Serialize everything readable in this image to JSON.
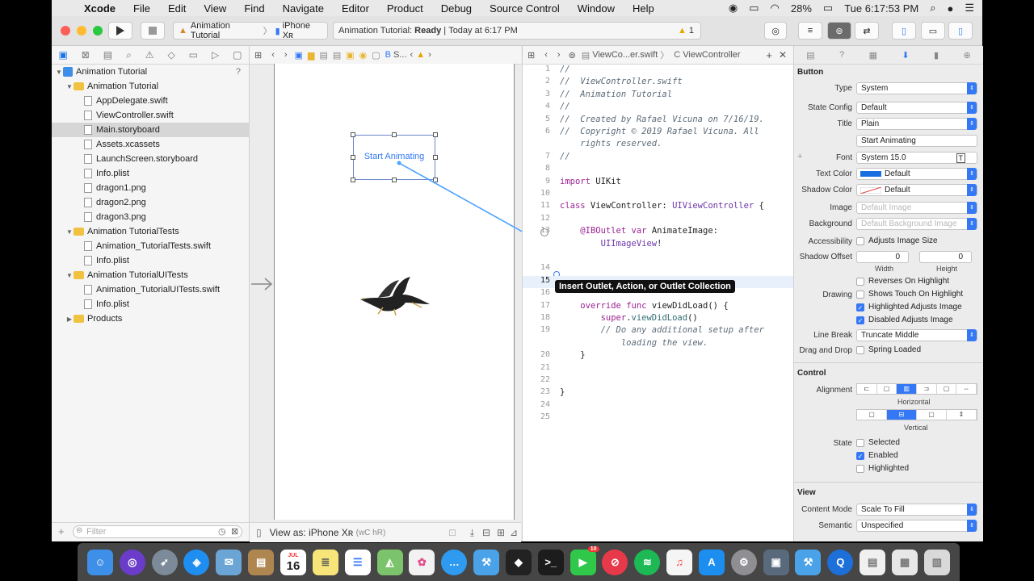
{
  "menubar": {
    "apple": "",
    "app_name": "Xcode",
    "items": [
      "File",
      "Edit",
      "View",
      "Find",
      "Navigate",
      "Editor",
      "Product",
      "Debug",
      "Source Control",
      "Window",
      "Help"
    ],
    "battery": "28%",
    "clock": "Tue 6:17:53 PM"
  },
  "toolbar": {
    "scheme": "Animation Tutorial",
    "device": "iPhone Xʀ",
    "status_app": "Animation Tutorial:",
    "status_state": "Ready",
    "status_time": "Today at 6:17 PM",
    "warning_count": "1"
  },
  "navigator": {
    "rows": [
      {
        "label": "Animation Tutorial",
        "kind": "project",
        "indent": 0,
        "tri": "▼",
        "extra": "?"
      },
      {
        "label": "Animation Tutorial",
        "kind": "folder",
        "indent": 1,
        "tri": "▼"
      },
      {
        "label": "AppDelegate.swift",
        "kind": "file",
        "indent": 2,
        "tri": ""
      },
      {
        "label": "ViewController.swift",
        "kind": "file",
        "indent": 2,
        "tri": ""
      },
      {
        "label": "Main.storyboard",
        "kind": "file",
        "indent": 2,
        "tri": "",
        "selected": true
      },
      {
        "label": "Assets.xcassets",
        "kind": "file",
        "indent": 2,
        "tri": ""
      },
      {
        "label": "LaunchScreen.storyboard",
        "kind": "file",
        "indent": 2,
        "tri": ""
      },
      {
        "label": "Info.plist",
        "kind": "file",
        "indent": 2,
        "tri": ""
      },
      {
        "label": "dragon1.png",
        "kind": "file",
        "indent": 2,
        "tri": ""
      },
      {
        "label": "dragon2.png",
        "kind": "file",
        "indent": 2,
        "tri": ""
      },
      {
        "label": "dragon3.png",
        "kind": "file",
        "indent": 2,
        "tri": ""
      },
      {
        "label": "Animation TutorialTests",
        "kind": "folder",
        "indent": 1,
        "tri": "▼"
      },
      {
        "label": "Animation_TutorialTests.swift",
        "kind": "file",
        "indent": 2,
        "tri": ""
      },
      {
        "label": "Info.plist",
        "kind": "file",
        "indent": 2,
        "tri": ""
      },
      {
        "label": "Animation TutorialUITests",
        "kind": "folder",
        "indent": 1,
        "tri": "▼"
      },
      {
        "label": "Animation_TutorialUITests.swift",
        "kind": "file",
        "indent": 2,
        "tri": ""
      },
      {
        "label": "Info.plist",
        "kind": "file",
        "indent": 2,
        "tri": ""
      },
      {
        "label": "Products",
        "kind": "folder",
        "indent": 1,
        "tri": "▶"
      }
    ],
    "filter_placeholder": "Filter"
  },
  "canvas": {
    "jump_tail": "S...",
    "button_title": "Start Animating",
    "view_as": "View as: iPhone Xʀ",
    "size_class": "(wC hR)"
  },
  "editor": {
    "jump_file": "ViewCo...er.swift",
    "jump_symbol": "ViewController",
    "tooltip": "Insert Outlet, Action, or Outlet Collection",
    "lines": [
      {
        "n": "1",
        "html": "<span class='cm'>//</span>"
      },
      {
        "n": "2",
        "html": "<span class='cm'>//  ViewController.swift</span>"
      },
      {
        "n": "3",
        "html": "<span class='cm'>//  Animation Tutorial</span>"
      },
      {
        "n": "4",
        "html": "<span class='cm'>//</span>"
      },
      {
        "n": "5",
        "html": "<span class='cm'>//  Created by Rafael Vicuna on 7/16/19.</span>"
      },
      {
        "n": "6",
        "html": "<span class='cm'>//  Copyright © 2019 Rafael Vicuna. All</span>"
      },
      {
        "n": "",
        "html": "<span class='cm'>    rights reserved.</span>"
      },
      {
        "n": "7",
        "html": "<span class='cm'>//</span>"
      },
      {
        "n": "8",
        "html": ""
      },
      {
        "n": "9",
        "html": "<span class='kw'>import</span> UIKit"
      },
      {
        "n": "10",
        "html": ""
      },
      {
        "n": "11",
        "html": "<span class='kw'>class</span> ViewController: <span class='ty'>UIViewController</span> {"
      },
      {
        "n": "12",
        "html": ""
      },
      {
        "n": "13",
        "html": "    <span class='kw'>@IBOutlet</span> <span class='kw'>var</span> AnimateImage:"
      },
      {
        "n": "",
        "html": "        <span class='ty'>UIImageView</span>!"
      },
      {
        "n": "",
        "html": ""
      },
      {
        "n": "14",
        "html": ""
      },
      {
        "n": "15",
        "html": ""
      },
      {
        "n": "16",
        "html": ""
      },
      {
        "n": "17",
        "html": "    <span class='kw'>override</span> <span class='kw'>func</span> viewDidLoad() {"
      },
      {
        "n": "18",
        "html": "        <span class='kw'>super</span>.<span class='fn'>viewDidLoad</span>()"
      },
      {
        "n": "19",
        "html": "        <span class='cm'>// Do any additional setup after</span>"
      },
      {
        "n": "",
        "html": "<span class='cm'>            loading the view.</span>"
      },
      {
        "n": "20",
        "html": "    }"
      },
      {
        "n": "21",
        "html": ""
      },
      {
        "n": "22",
        "html": ""
      },
      {
        "n": "23",
        "html": "}"
      },
      {
        "n": "24",
        "html": ""
      },
      {
        "n": "25",
        "html": ""
      }
    ]
  },
  "inspector": {
    "section_button": "Button",
    "type_label": "Type",
    "type_value": "System",
    "state_config_label": "State Config",
    "state_config_value": "Default",
    "title_label": "Title",
    "title_value": "Plain",
    "title_text": "Start Animating",
    "font_label": "Font",
    "font_value": "System 15.0",
    "text_color_label": "Text Color",
    "text_color_value": "Default",
    "shadow_color_label": "Shadow Color",
    "shadow_color_value": "Default",
    "image_label": "Image",
    "image_placeholder": "Default Image",
    "background_label": "Background",
    "background_placeholder": "Default Background Image",
    "accessibility_label": "Accessibility",
    "adjusts_image_size": "Adjusts Image Size",
    "shadow_offset_label": "Shadow Offset",
    "shadow_w": "0",
    "shadow_h": "0",
    "width_label": "Width",
    "height_label": "Height",
    "reverses": "Reverses On Highlight",
    "drawing_label": "Drawing",
    "shows_touch": "Shows Touch On Highlight",
    "highlighted_adjusts": "Highlighted Adjusts Image",
    "disabled_adjusts": "Disabled Adjusts Image",
    "line_break_label": "Line Break",
    "line_break_value": "Truncate Middle",
    "drag_drop_label": "Drag and Drop",
    "spring_loaded": "Spring Loaded",
    "section_control": "Control",
    "alignment_label": "Alignment",
    "horizontal": "Horizontal",
    "vertical": "Vertical",
    "state_label": "State",
    "selected": "Selected",
    "enabled": "Enabled",
    "highlighted": "Highlighted",
    "section_view": "View",
    "content_mode_label": "Content Mode",
    "content_mode_value": "Scale To Fill",
    "semantic_label": "Semantic",
    "semantic_value": "Unspecified",
    "text_color_swatch": "#1a6fe0"
  },
  "dock": {
    "calendar_month": "JUL",
    "calendar_day": "16",
    "messages_badge": "10"
  }
}
